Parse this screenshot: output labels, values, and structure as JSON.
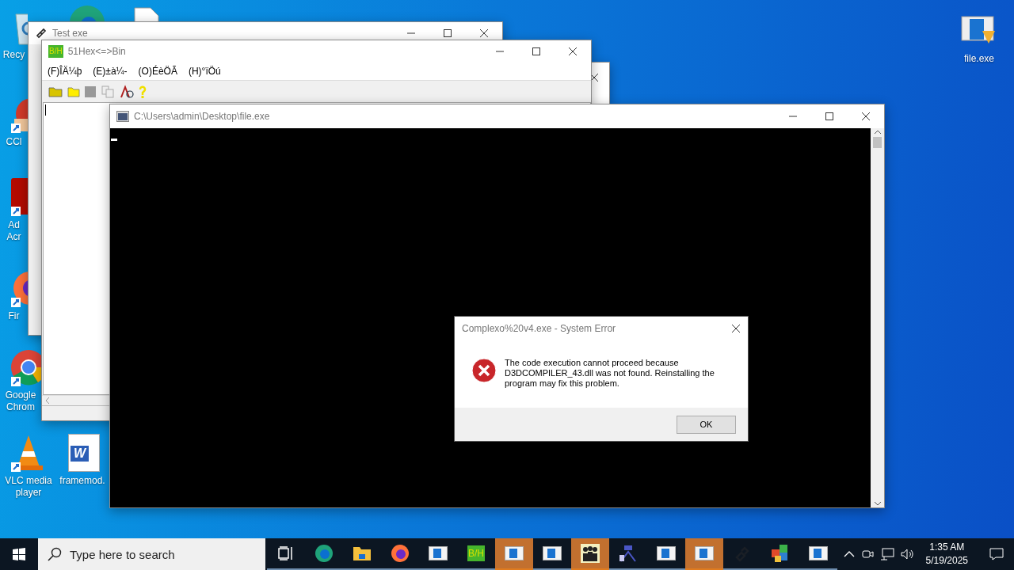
{
  "desktop_icons": [
    {
      "kind": "recycle",
      "label": "Recy"
    },
    {
      "kind": "browser-edge"
    },
    {
      "kind": "document"
    },
    {
      "kind": "ccleaner",
      "label": "CCl"
    },
    {
      "kind": "acrobat",
      "label": "Ad\nAcr"
    },
    {
      "kind": "firefox",
      "label": "Fir"
    },
    {
      "kind": "chrome",
      "label": "Google\nChrom"
    },
    {
      "kind": "vlc",
      "label": "VLC media\nplayer"
    },
    {
      "kind": "word",
      "label": "framemod.",
      "logo_text": "W"
    },
    {
      "kind": "exe",
      "label": "file.exe"
    }
  ],
  "test_window": {
    "title": "Test exe"
  },
  "hex_window": {
    "title": "51Hex<=>Bin",
    "logo_text": "B/H",
    "menu": [
      "(F)ÎÄ¼þ",
      "(E)±à¼-",
      "(O)ÉèÖÃ",
      "(H)°ïÖú"
    ]
  },
  "console_window": {
    "title": "C:\\Users\\admin\\Desktop\\file.exe"
  },
  "error_dialog": {
    "title": "Complexo%20v4.exe - System Error",
    "message": "The code execution cannot proceed because D3DCOMPILER_43.dll was not found. Reinstalling the program may fix this problem.",
    "button": "OK"
  },
  "taskbar": {
    "search": {
      "placeholder": "Type here to search"
    },
    "apps": [
      {
        "kind": "taskview",
        "flashing": false
      },
      {
        "kind": "edge",
        "flashing": false
      },
      {
        "kind": "explorer",
        "flashing": false
      },
      {
        "kind": "firefox",
        "flashing": false
      },
      {
        "kind": "window",
        "flashing": false
      },
      {
        "kind": "hex",
        "flashing": false,
        "logo_text": "B/H"
      },
      {
        "kind": "window",
        "flashing": true
      },
      {
        "kind": "window",
        "flashing": false
      },
      {
        "kind": "people",
        "flashing": true
      },
      {
        "kind": "network",
        "flashing": false
      },
      {
        "kind": "window",
        "flashing": false
      },
      {
        "kind": "window",
        "flashing": true
      },
      {
        "kind": "link",
        "flashing": false
      },
      {
        "kind": "blocks",
        "flashing": false
      },
      {
        "kind": "window",
        "flashing": false
      }
    ],
    "time": "1:35 AM",
    "date": "5/19/2025"
  }
}
